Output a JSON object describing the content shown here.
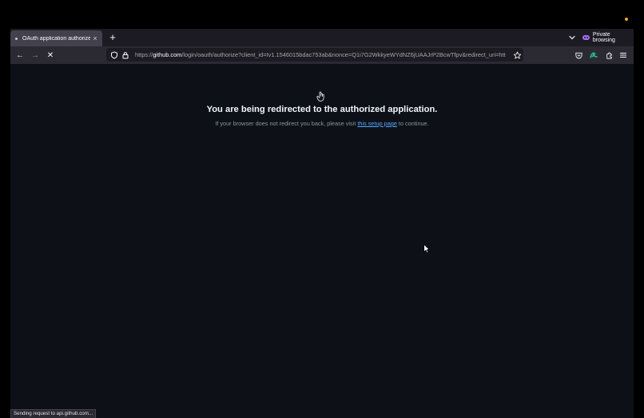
{
  "browser": {
    "tab": {
      "title": "OAuth application authorized",
      "close_glyph": "×"
    },
    "new_tab_glyph": "+",
    "private_label": "Private browsing",
    "nav": {
      "back_glyph": "←",
      "forward_glyph": "→",
      "stop_glyph": "✕"
    },
    "url": {
      "prefix": "https://",
      "host": "github.com",
      "rest": "/login/oauth/authorize?client_id=Iv1.1546015bdac753ab&nonce=Q1i7G2WkkyeWYdNZ6jUAAJrP2BcwTfpv&redirect_uri=htt"
    },
    "icons": [
      "shield-icon",
      "lock-icon",
      "star-icon",
      "pocket-icon",
      "extension-icon",
      "puzzle-icon",
      "menu-icon"
    ],
    "accent_colors": {
      "private": "#a66ef8",
      "extension": "#2ac3a2"
    }
  },
  "page": {
    "heading": "You are being redirected to the authorized application.",
    "sub_before": "If your browser does not redirect you back, please visit ",
    "sub_link": "this setup page",
    "sub_after": " to continue.",
    "link_color": "#58a6ff"
  },
  "status": {
    "text": "Sending request to api.github.com..."
  }
}
